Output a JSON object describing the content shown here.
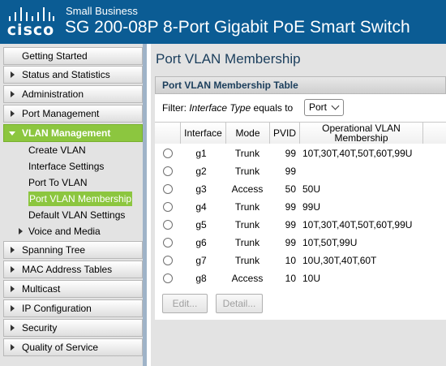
{
  "header": {
    "brand": "cisco",
    "brand_line": "Small Business",
    "product_title": "SG 200-08P 8-Port Gigabit PoE Smart Switch",
    "background_color": "#0b5c94"
  },
  "sidebar": {
    "items_before": [
      {
        "label": "Getting Started",
        "expandable": false
      },
      {
        "label": "Status and Statistics",
        "expandable": true
      },
      {
        "label": "Administration",
        "expandable": true
      },
      {
        "label": "Port Management",
        "expandable": true
      }
    ],
    "active_item": {
      "label": "VLAN Management",
      "expanded": true
    },
    "sub_items": [
      {
        "label": "Create VLAN"
      },
      {
        "label": "Interface Settings"
      },
      {
        "label": "Port To VLAN"
      },
      {
        "label": "Port VLAN Membership",
        "selected": true
      },
      {
        "label": "Default VLAN Settings"
      },
      {
        "label": "Voice and Media",
        "expandable": true
      }
    ],
    "items_after": [
      {
        "label": "Spanning Tree",
        "expandable": true
      },
      {
        "label": "MAC Address Tables",
        "expandable": true
      },
      {
        "label": "Multicast",
        "expandable": true
      },
      {
        "label": "IP Configuration",
        "expandable": true
      },
      {
        "label": "Security",
        "expandable": true
      },
      {
        "label": "Quality of Service",
        "expandable": true
      }
    ],
    "accent_color": "#8cc63f"
  },
  "main": {
    "page_title": "Port VLAN Membership",
    "panel_title": "Port VLAN Membership Table",
    "filter": {
      "prefix": "Filter:",
      "field": "Interface Type",
      "operator": "equals to",
      "selected_value": "Port"
    },
    "table": {
      "columns": [
        "Interface",
        "Mode",
        "PVID",
        "Operational VLAN Membership"
      ],
      "rows": [
        {
          "interface": "g1",
          "mode": "Trunk",
          "pvid": "99",
          "membership": "10T,30T,40T,50T,60T,99U"
        },
        {
          "interface": "g2",
          "mode": "Trunk",
          "pvid": "99",
          "membership": ""
        },
        {
          "interface": "g3",
          "mode": "Access",
          "pvid": "50",
          "membership": "50U"
        },
        {
          "interface": "g4",
          "mode": "Trunk",
          "pvid": "99",
          "membership": "99U"
        },
        {
          "interface": "g5",
          "mode": "Trunk",
          "pvid": "99",
          "membership": "10T,30T,40T,50T,60T,99U"
        },
        {
          "interface": "g6",
          "mode": "Trunk",
          "pvid": "99",
          "membership": "10T,50T,99U"
        },
        {
          "interface": "g7",
          "mode": "Trunk",
          "pvid": "10",
          "membership": "10U,30T,40T,60T"
        },
        {
          "interface": "g8",
          "mode": "Access",
          "pvid": "10",
          "membership": "10U"
        }
      ]
    },
    "buttons": {
      "edit": "Edit...",
      "detail": "Detail..."
    }
  }
}
